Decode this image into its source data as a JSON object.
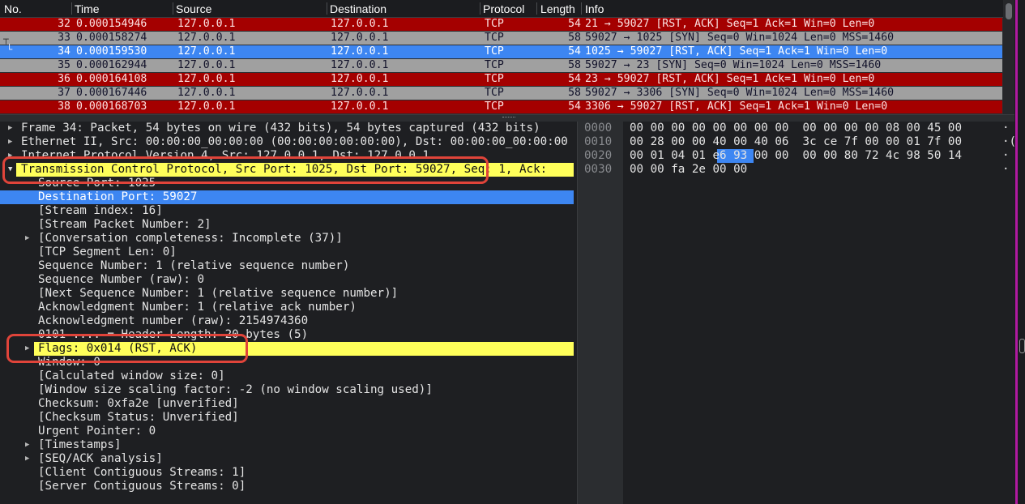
{
  "columns": {
    "no": "No.",
    "time": "Time",
    "source": "Source",
    "destination": "Destination",
    "protocol": "Protocol",
    "length": "Length",
    "info": "Info"
  },
  "packets": [
    {
      "no": "32",
      "time": "0.000154946",
      "src": "127.0.0.1",
      "dst": "127.0.0.1",
      "proto": "TCP",
      "len": "54",
      "info": "21 → 59027 [RST, ACK] Seq=1 Ack=1 Win=0 Len=0"
    },
    {
      "no": "33",
      "time": "0.000158274",
      "src": "127.0.0.1",
      "dst": "127.0.0.1",
      "proto": "TCP",
      "len": "58",
      "info": "59027 → 1025 [SYN] Seq=0 Win=1024 Len=0 MSS=1460"
    },
    {
      "no": "34",
      "time": "0.000159530",
      "src": "127.0.0.1",
      "dst": "127.0.0.1",
      "proto": "TCP",
      "len": "54",
      "info": "1025 → 59027 [RST, ACK] Seq=1 Ack=1 Win=0 Len=0"
    },
    {
      "no": "35",
      "time": "0.000162944",
      "src": "127.0.0.1",
      "dst": "127.0.0.1",
      "proto": "TCP",
      "len": "58",
      "info": "59027 → 23 [SYN] Seq=0 Win=1024 Len=0 MSS=1460"
    },
    {
      "no": "36",
      "time": "0.000164108",
      "src": "127.0.0.1",
      "dst": "127.0.0.1",
      "proto": "TCP",
      "len": "54",
      "info": "23 → 59027 [RST, ACK] Seq=1 Ack=1 Win=0 Len=0"
    },
    {
      "no": "37",
      "time": "0.000167446",
      "src": "127.0.0.1",
      "dst": "127.0.0.1",
      "proto": "TCP",
      "len": "58",
      "info": "59027 → 3306 [SYN] Seq=0 Win=1024 Len=0 MSS=1460"
    },
    {
      "no": "38",
      "time": "0.000168703",
      "src": "127.0.0.1",
      "dst": "127.0.0.1",
      "proto": "TCP",
      "len": "54",
      "info": "3306 → 59027 [RST, ACK] Seq=1 Ack=1 Win=0 Len=0"
    }
  ],
  "details": {
    "frame": "Frame 34: Packet, 54 bytes on wire (432 bits), 54 bytes captured (432 bits)",
    "ethernet": "Ethernet II, Src: 00:00:00_00:00:00 (00:00:00:00:00:00), Dst: 00:00:00_00:00:00",
    "ip": "Internet Protocol Version 4, Src: 127.0.0.1, Dst: 127.0.0.1",
    "tcp": "Transmission Control Protocol, Src Port: 1025, Dst Port: 59027, Seq: 1, Ack:",
    "src_port": "Source Port: 1025",
    "dst_port": "Destination Port: 59027",
    "stream_index": "[Stream index: 16]",
    "stream_packet": "[Stream Packet Number: 2]",
    "conversation": "[Conversation completeness: Incomplete (37)]",
    "seg_len": "[TCP Segment Len: 0]",
    "seq": "Sequence Number: 1    (relative sequence number)",
    "seq_raw": "Sequence Number (raw): 0",
    "next_seq": "[Next Sequence Number: 1    (relative sequence number)]",
    "ack": "Acknowledgment Number: 1    (relative ack number)",
    "ack_raw": "Acknowledgment number (raw): 2154974360",
    "header_len": "0101 .... = Header Length: 20 bytes (5)",
    "flags": "Flags: 0x014 (RST, ACK)",
    "window": "Window: 0",
    "calc_window": "[Calculated window size: 0]",
    "window_scaling": "[Window size scaling factor: -2 (no window scaling used)]",
    "checksum": "Checksum: 0xfa2e [unverified]",
    "checksum_status": "[Checksum Status: Unverified]",
    "urgent": "Urgent Pointer: 0",
    "timestamps": "[Timestamps]",
    "seq_ack": "[SEQ/ACK analysis]",
    "client_streams": "[Client Contiguous Streams: 1]",
    "server_streams": "[Server Contiguous Streams: 0]"
  },
  "bytes": [
    {
      "offset": "0000",
      "hex_a": "00 00 00 00 00 00 00 00  00 00 00 00 08 00 45 00",
      "ascii": "·"
    },
    {
      "offset": "0010",
      "hex_a": "00 28 00 00 40 00 40 06  3c ce 7f 00 00 01 7f 00",
      "ascii": "·("
    },
    {
      "offset": "0020",
      "hex_a": "00 01 04 01 e6 93 00 00  00 00 80 72 4c 98 50 14",
      "ascii": "·"
    },
    {
      "offset": "0030",
      "hex_a": "00 00 fa 2e 00 00",
      "ascii": "·"
    }
  ],
  "colors": {
    "rst_row": "#a40000",
    "syn_row": "#a0a0a0",
    "selected": "#3d86f2",
    "highlight": "#ffff5a",
    "annotation": "#e0443a"
  }
}
